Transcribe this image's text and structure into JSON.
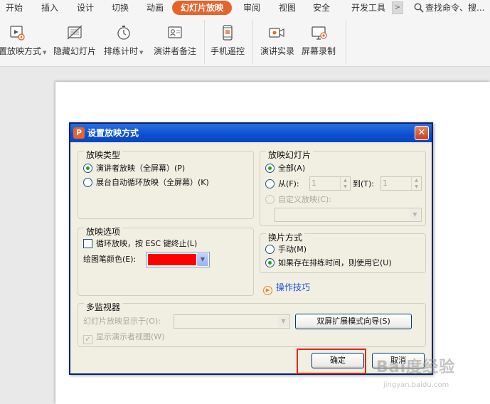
{
  "menu": {
    "tabs": [
      {
        "label": "开始"
      },
      {
        "label": "插入"
      },
      {
        "label": "设计"
      },
      {
        "label": "切换"
      },
      {
        "label": "动画"
      },
      {
        "label": "幻灯片放映",
        "active": true
      },
      {
        "label": "审阅"
      },
      {
        "label": "视图"
      },
      {
        "label": "安全"
      },
      {
        "label": "开发工具"
      }
    ],
    "more_symbol": ">",
    "search_placeholder": "查找命令、搜..."
  },
  "ribbon": {
    "buttons": [
      {
        "label": "置放映方式",
        "icon": "slideshow-settings-icon",
        "has_dropdown": true
      },
      {
        "label": "隐藏幻灯片",
        "icon": "hide-slide-icon"
      },
      {
        "label": "排练计时",
        "icon": "timer-icon",
        "has_dropdown": true
      },
      {
        "label": "演讲者备注",
        "icon": "speaker-notes-icon"
      },
      {
        "label": "手机遥控",
        "icon": "phone-remote-icon"
      },
      {
        "label": "演讲实录",
        "icon": "record-icon"
      },
      {
        "label": "屏幕录制",
        "icon": "screen-record-icon"
      }
    ]
  },
  "dialog": {
    "title": "设置放映方式",
    "icon_letter": "P",
    "show_type": {
      "title": "放映类型",
      "options": [
        "演讲者放映（全屏幕）(P)",
        "展台自动循环放映（全屏幕）(K)"
      ],
      "selected_index": 0
    },
    "show_slides": {
      "title": "放映幻灯片",
      "all_label": "全部(A)",
      "from_label": "从(F):",
      "from_value": "1",
      "to_label": "到(T):",
      "to_value": "1",
      "custom_label": "自定义放映(C):",
      "custom_value": ""
    },
    "show_options": {
      "title": "放映选项",
      "loop_label": "循环放映，按 ESC 键终止(L)",
      "pen_color_label": "绘图笔颜色(E):",
      "pen_color": "#ff0000"
    },
    "advance": {
      "title": "换片方式",
      "options": [
        "手动(M)",
        "如果存在排练时间，则使用它(U)"
      ],
      "selected_index": 1
    },
    "tips_label": "操作技巧",
    "monitors": {
      "title": "多监视器",
      "display_on_label": "幻灯片放映显示于(O):",
      "display_on_value": "",
      "presenter_view_label": "显示演示者视图(W)",
      "dual_screen_button": "双屏扩展模式向导(S)"
    },
    "ok_label": "确定",
    "cancel_label": "取消"
  },
  "watermark": {
    "logo": "Bai度经验",
    "url": "jingyan.baidu.com"
  },
  "colors": {
    "accent": "#e8632b",
    "titlebar": "#0b4fd0",
    "highlight": "#e0261b"
  }
}
